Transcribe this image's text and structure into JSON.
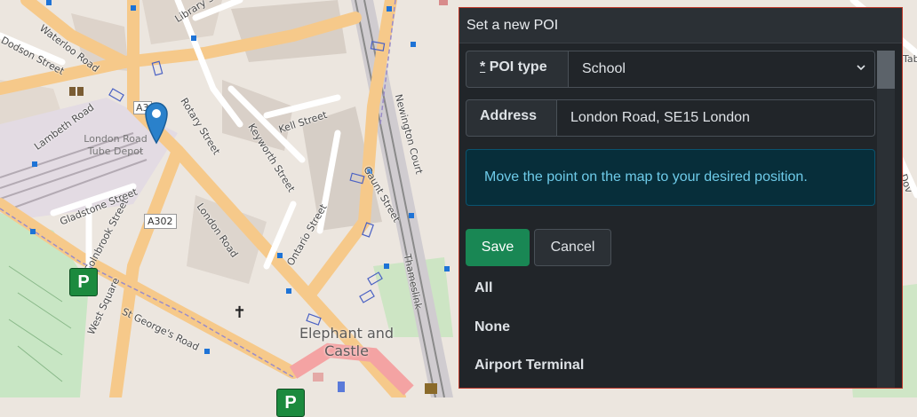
{
  "map": {
    "streets": {
      "dodson": "Dodson Street",
      "waterloo": "Waterloo Road",
      "library": "Library St",
      "rotary": "Rotary Street",
      "lambeth": "Lambeth Road",
      "a3": "A3",
      "kell": "Kell Street",
      "keyworth": "Keyworth Street",
      "newington": "Newington Court",
      "gaunt": "Gaunt Street",
      "gladstone": "Gladstone Street",
      "colnbrook": "Colnbrook Street",
      "london_road": "London Road",
      "ontario": "Ontario Street",
      "thameslink": "Thameslink",
      "west_square": "West Square",
      "st_georges": "St George's Road"
    },
    "depot": "London Road Tube Depot",
    "shield_a302": "A302",
    "place": "Elephant and Castle",
    "parking_symbol": "P",
    "church_symbol": "✝",
    "edge_tab": "Tab",
    "edge_dov": "Dov"
  },
  "panel": {
    "title": "Set a new POI",
    "poi_type": {
      "required_mark": "*",
      "label": "POI type",
      "value": "School"
    },
    "address": {
      "label": "Address",
      "value": "London Road, SE15 London"
    },
    "info": "Move the point on the map to your desired position.",
    "buttons": {
      "save": "Save",
      "cancel": "Cancel"
    },
    "options": [
      "All",
      "None",
      "Airport Terminal"
    ]
  },
  "colors": {
    "save_green": "#198754",
    "info_text": "#6ecbe9",
    "panel_border": "#c0392b",
    "pin_blue": "#2a81cb"
  }
}
